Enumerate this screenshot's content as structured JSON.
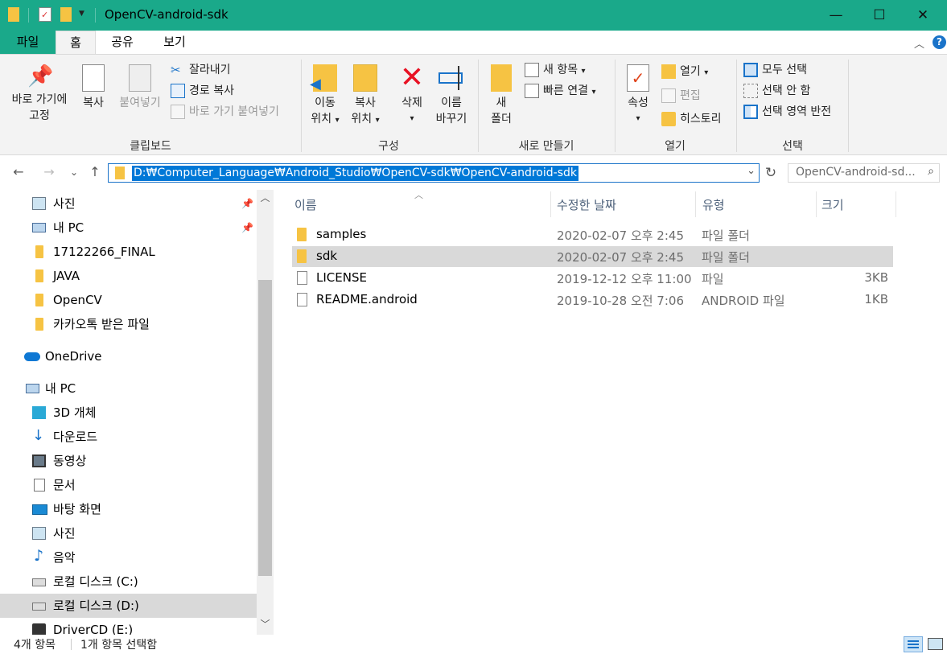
{
  "window": {
    "title": "OpenCV-android-sdk",
    "minimize_glyph": "—",
    "maximize_glyph": "☐",
    "close_glyph": "✕"
  },
  "ribbon_tabs": {
    "file": "파일",
    "home": "홈",
    "share": "공유",
    "view": "보기"
  },
  "ribbon": {
    "clipboard": {
      "pin_quick_access": [
        "바로 가기에",
        "고정"
      ],
      "copy": "복사",
      "paste": "붙여넣기",
      "cut": "잘라내기",
      "copy_path": "경로 복사",
      "paste_shortcut": "바로 가기 붙여넣기",
      "group_label": "클립보드"
    },
    "organize": {
      "move_to": [
        "이동",
        "위치"
      ],
      "copy_to": [
        "복사",
        "위치"
      ],
      "delete": "삭제",
      "rename": [
        "이름",
        "바꾸기"
      ],
      "group_label": "구성"
    },
    "new": {
      "new_folder": [
        "새",
        "폴더"
      ],
      "new_item": "새 항목",
      "easy_access": "빠른 연결",
      "group_label": "새로 만들기"
    },
    "open": {
      "properties": "속성",
      "open": "열기",
      "edit": "편집",
      "history": "히스토리",
      "group_label": "열기"
    },
    "select": {
      "select_all": "모두 선택",
      "select_none": "선택 안 함",
      "invert_selection": "선택 영역 반전",
      "group_label": "선택"
    }
  },
  "address": {
    "path": "D:₩Computer_Language₩Android_Studio₩OpenCV-sdk₩OpenCV-android-sdk",
    "search_placeholder": "OpenCV-android-sd..."
  },
  "nav_pane": {
    "quick_access": [
      {
        "label": "사진",
        "icon": "pictures-icon",
        "pinned": true
      },
      {
        "label": "내 PC",
        "icon": "computer-icon",
        "pinned": true
      },
      {
        "label": "17122266_FINAL",
        "icon": "folder-icon"
      },
      {
        "label": "JAVA",
        "icon": "folder-icon"
      },
      {
        "label": "OpenCV",
        "icon": "folder-icon"
      },
      {
        "label": "카카오톡 받은 파일",
        "icon": "folder-icon"
      }
    ],
    "onedrive": "OneDrive",
    "this_pc": "내 PC",
    "this_pc_items": [
      {
        "label": "3D 개체",
        "icon": "3d-objects-icon"
      },
      {
        "label": "다운로드",
        "icon": "downloads-icon"
      },
      {
        "label": "동영상",
        "icon": "videos-icon"
      },
      {
        "label": "문서",
        "icon": "documents-icon"
      },
      {
        "label": "바탕 화면",
        "icon": "desktop-icon"
      },
      {
        "label": "사진",
        "icon": "pictures-icon"
      },
      {
        "label": "음악",
        "icon": "music-icon"
      },
      {
        "label": "로컬 디스크 (C:)",
        "icon": "drive-c-icon"
      },
      {
        "label": "로컬 디스크 (D:)",
        "icon": "drive-d-icon",
        "selected": true
      },
      {
        "label": "DriverCD (E:)",
        "icon": "cd-drive-icon"
      }
    ]
  },
  "file_list": {
    "columns": {
      "name": "이름",
      "date": "수정한 날짜",
      "type": "유형",
      "size": "크기"
    },
    "rows": [
      {
        "name": "samples",
        "date": "2020-02-07 오후 2:45",
        "type": "파일 폴더",
        "size": "",
        "kind": "folder"
      },
      {
        "name": "sdk",
        "date": "2020-02-07 오후 2:45",
        "type": "파일 폴더",
        "size": "",
        "kind": "folder",
        "selected": true
      },
      {
        "name": "LICENSE",
        "date": "2019-12-12 오후 11:00",
        "type": "파일",
        "size": "3KB",
        "kind": "file"
      },
      {
        "name": "README.android",
        "date": "2019-10-28 오전 7:06",
        "type": "ANDROID 파일",
        "size": "1KB",
        "kind": "file"
      }
    ]
  },
  "status": {
    "item_count": "4개 항목",
    "selected_count": "1개 항목 선택함"
  },
  "colors": {
    "titlebar": "#1aa98a",
    "selection": "#0078d7",
    "folder": "#f6c343"
  }
}
